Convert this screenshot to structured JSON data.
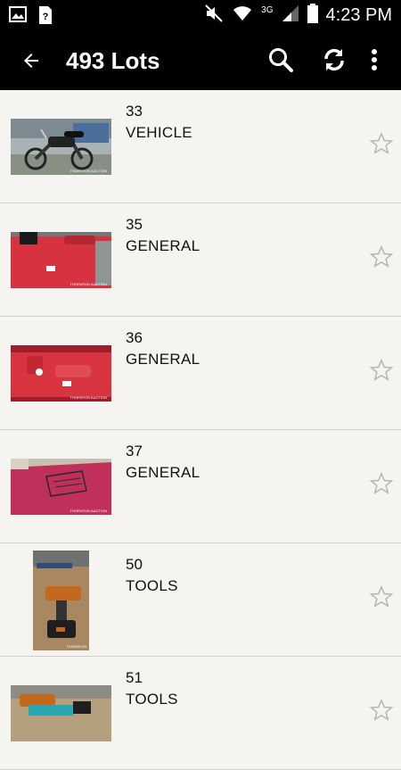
{
  "status_bar": {
    "time": "4:23 PM",
    "network": "3G"
  },
  "app_bar": {
    "title": "493 Lots"
  },
  "lots": [
    {
      "number": "33",
      "category": "VEHICLE",
      "image": "motorcycle-photo"
    },
    {
      "number": "35",
      "category": "GENERAL",
      "image": "red-fuel-tank-photo"
    },
    {
      "number": "36",
      "category": "GENERAL",
      "image": "red-fuel-tank-photo"
    },
    {
      "number": "37",
      "category": "GENERAL",
      "image": "red-bag-photo"
    },
    {
      "number": "50",
      "category": "TOOLS",
      "image": "power-drill-photo"
    },
    {
      "number": "51",
      "category": "TOOLS",
      "image": "tools-photo"
    }
  ],
  "colors": {
    "app_bar": "#000000",
    "list_background": "#f5f4f0",
    "divider": "#cfcfcf",
    "star_outline": "#b5b5b5"
  }
}
